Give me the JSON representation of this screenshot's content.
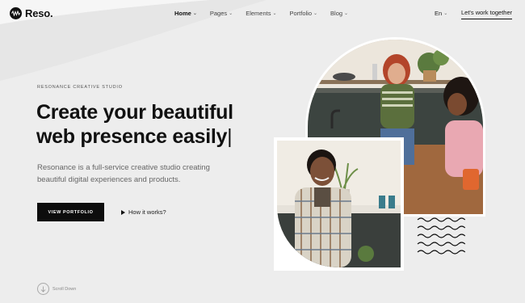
{
  "brand": {
    "name": "Reso."
  },
  "nav": {
    "items": [
      {
        "label": "Home",
        "active": true
      },
      {
        "label": "Pages",
        "active": false
      },
      {
        "label": "Elements",
        "active": false
      },
      {
        "label": "Portfolio",
        "active": false
      },
      {
        "label": "Blog",
        "active": false
      }
    ],
    "language": "En",
    "cta": "Let's work together"
  },
  "hero": {
    "eyebrow": "RESONANCE CREATIVE STUDIO",
    "headline_line1": "Create your beautiful",
    "headline_line2": "web presence easily",
    "cursor": "|",
    "subtext": "Resonance is a full-service creative studio creating beautiful digital experiences and products.",
    "primary_button": "VIEW PORTFOLIO",
    "secondary_button": "How it works?",
    "scroll_label": "Scroll Down"
  },
  "colors": {
    "background": "#ededed",
    "accent_dark": "#0d0d0d",
    "muted_text": "#666666"
  }
}
